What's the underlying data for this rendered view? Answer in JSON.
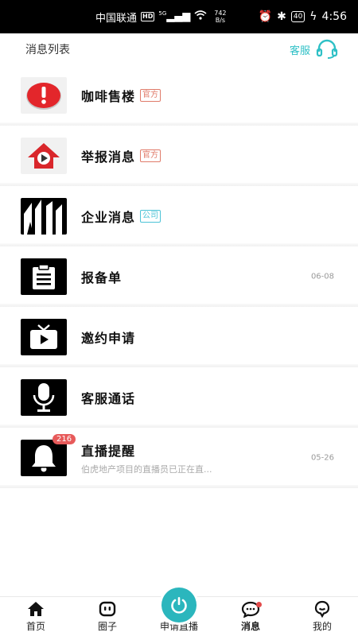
{
  "status_bar": {
    "carrier": "中国联通",
    "hd": "HD",
    "signal": "5G",
    "speed_value": "742",
    "speed_unit": "B/s",
    "battery": "40",
    "time": "4:56"
  },
  "header": {
    "title": "消息列表",
    "service_label": "客服",
    "accent": "#2ec0c6"
  },
  "messages": [
    {
      "title": "咖啡售楼",
      "tag": "官方",
      "icon": "alert-icon"
    },
    {
      "title": "举报消息",
      "tag": "官方",
      "icon": "report-icon"
    },
    {
      "title": "企业消息",
      "tag": "公司",
      "icon": "building-icon"
    },
    {
      "title": "报备单",
      "date": "06-08",
      "icon": "clipboard-icon"
    },
    {
      "title": "邀约申请",
      "icon": "tv-icon"
    },
    {
      "title": "客服通话",
      "icon": "microphone-icon"
    },
    {
      "title": "直播提醒",
      "preview": "伯虎地产项目的直播员已正在直...",
      "date": "05-26",
      "badge": "216",
      "icon": "bell-icon"
    }
  ],
  "tabbar": {
    "tabs": [
      {
        "label": "首页",
        "icon": "home-icon"
      },
      {
        "label": "圈子",
        "icon": "circle-icon"
      },
      {
        "label": "申请直播",
        "icon": "power-icon"
      },
      {
        "label": "消息",
        "icon": "chat-icon"
      },
      {
        "label": "我的",
        "icon": "profile-icon"
      }
    ],
    "active": "消息"
  }
}
